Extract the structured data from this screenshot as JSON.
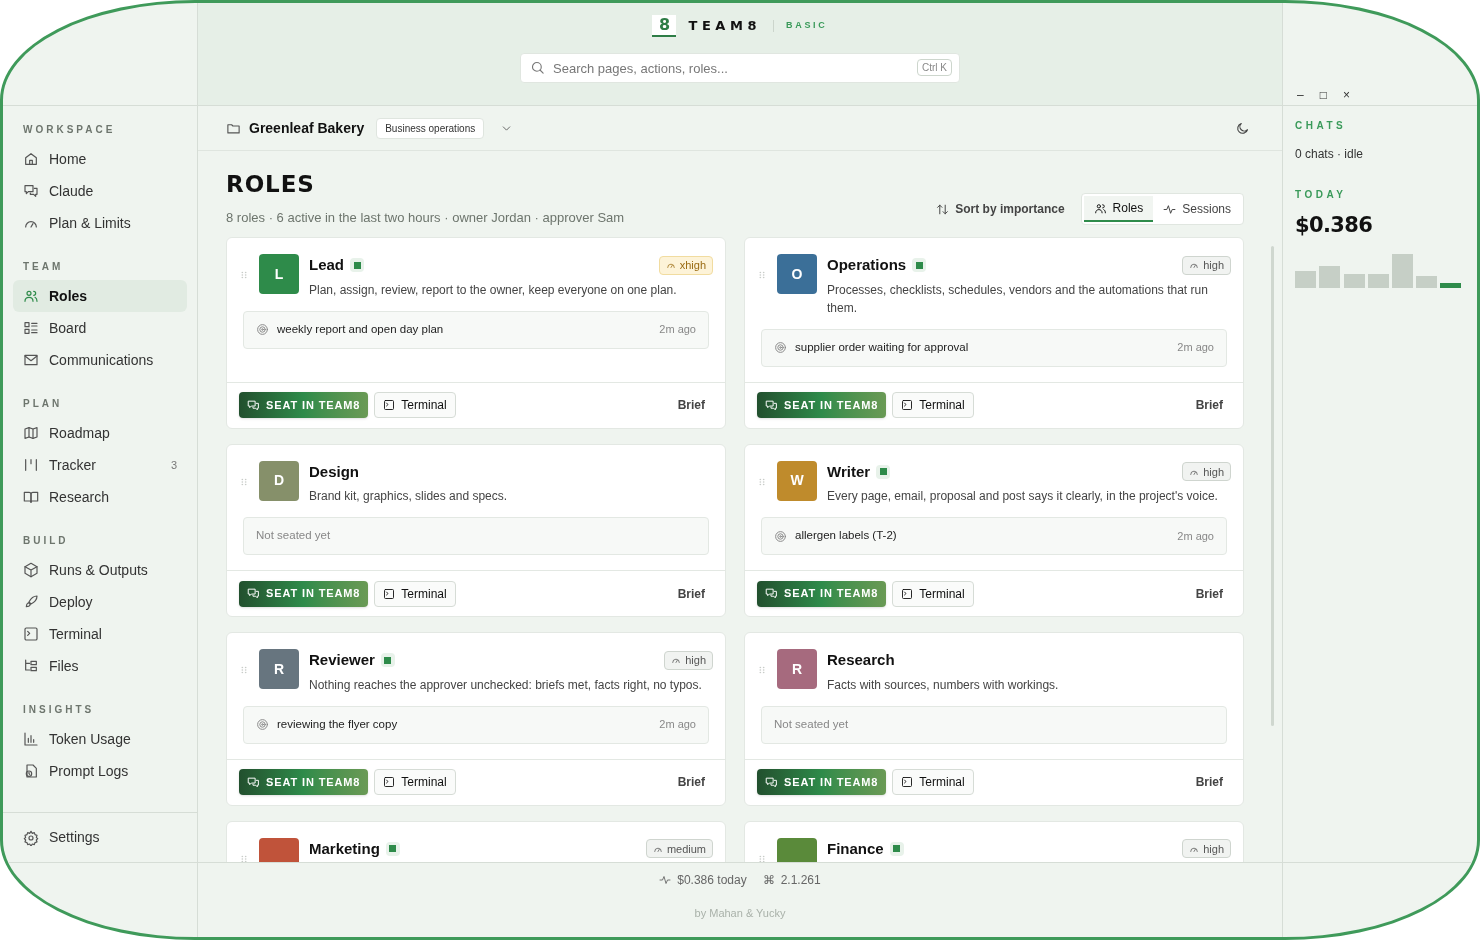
{
  "brand": {
    "logo": "8",
    "name": "TEAM8",
    "plan": "BASIC"
  },
  "search": {
    "placeholder": "Search pages, actions, roles...",
    "shortcut": "Ctrl K"
  },
  "window_controls": [
    "–",
    "□",
    "×"
  ],
  "sidebar": {
    "sections": [
      {
        "title": "WORKSPACE",
        "items": [
          {
            "label": "Home",
            "selected": false
          },
          {
            "label": "Claude",
            "selected": false
          },
          {
            "label": "Plan & Limits",
            "selected": false
          }
        ]
      },
      {
        "title": "TEAM",
        "items": [
          {
            "label": "Roles",
            "selected": true
          },
          {
            "label": "Board",
            "selected": false
          },
          {
            "label": "Communications",
            "selected": false
          }
        ]
      },
      {
        "title": "PLAN",
        "items": [
          {
            "label": "Roadmap",
            "selected": false
          },
          {
            "label": "Tracker",
            "selected": false,
            "count": "3"
          },
          {
            "label": "Research",
            "selected": false
          }
        ]
      },
      {
        "title": "BUILD",
        "items": [
          {
            "label": "Runs & Outputs",
            "selected": false
          },
          {
            "label": "Deploy",
            "selected": false
          },
          {
            "label": "Terminal",
            "selected": false
          },
          {
            "label": "Files",
            "selected": false
          }
        ]
      },
      {
        "title": "INSIGHTS",
        "items": [
          {
            "label": "Token Usage",
            "selected": false
          },
          {
            "label": "Prompt Logs",
            "selected": false
          }
        ]
      }
    ],
    "footer": {
      "label": "Settings"
    }
  },
  "project": {
    "name": "Greenleaf Bakery",
    "tag": "Business operations"
  },
  "page": {
    "title": "ROLES",
    "subtitle": "8 roles · 6 active in the last two hours · owner Jordan · approver Sam",
    "sort": "Sort by importance",
    "tabs": [
      {
        "label": "Roles",
        "selected": true
      },
      {
        "label": "Sessions",
        "selected": false
      }
    ]
  },
  "roles": [
    {
      "initial": "L",
      "color": "#2e8b4a",
      "name": "Lead",
      "online": true,
      "effort": "xhigh",
      "effort_highlighted": true,
      "description": "Plan, assign, review, report to the owner, keep everyone on one plan.",
      "activity": {
        "kind": "task",
        "text": "weekly report and open day plan",
        "time": "2m ago"
      },
      "seat": "SEAT IN TEAM8",
      "terminal": "Terminal",
      "brief": "Brief"
    },
    {
      "initial": "O",
      "color": "#3b6f98",
      "name": "Operations",
      "online": true,
      "effort": "high",
      "effort_highlighted": false,
      "description": "Processes, checklists, schedules, vendors and the automations that run them.",
      "activity": {
        "kind": "task",
        "text": "supplier order waiting for approval",
        "time": "2m ago"
      },
      "seat": "SEAT IN TEAM8",
      "terminal": "Terminal",
      "brief": "Brief"
    },
    {
      "initial": "D",
      "color": "#86906a",
      "name": "Design",
      "online": false,
      "description": "Brand kit, graphics, slides and specs.",
      "activity": {
        "kind": "empty",
        "text": "Not seated yet"
      },
      "seat": "SEAT IN TEAM8",
      "terminal": "Terminal",
      "brief": "Brief"
    },
    {
      "initial": "W",
      "color": "#bf8b2c",
      "name": "Writer",
      "online": true,
      "effort": "high",
      "effort_highlighted": false,
      "description": "Every page, email, proposal and post says it clearly, in the project's voice.",
      "activity": {
        "kind": "task",
        "text": "allergen labels (T-2)",
        "time": "2m ago"
      },
      "seat": "SEAT IN TEAM8",
      "terminal": "Terminal",
      "brief": "Brief"
    },
    {
      "initial": "R",
      "color": "#67757f",
      "name": "Reviewer",
      "online": true,
      "effort": "high",
      "effort_highlighted": false,
      "description": "Nothing reaches the approver unchecked: briefs met, facts right, no typos.",
      "activity": {
        "kind": "task",
        "text": "reviewing the flyer copy",
        "time": "2m ago"
      },
      "seat": "SEAT IN TEAM8",
      "terminal": "Terminal",
      "brief": "Brief"
    },
    {
      "initial": "R",
      "color": "#a66a7e",
      "name": "Research",
      "online": false,
      "description": "Facts with sources, numbers with workings.",
      "activity": {
        "kind": "empty",
        "text": "Not seated yet"
      },
      "seat": "SEAT IN TEAM8",
      "terminal": "Terminal",
      "brief": "Brief"
    },
    {
      "color": "#c0533a",
      "name": "Marketing",
      "online": true,
      "effort": "medium",
      "effort_highlighted": false
    },
    {
      "color": "#5a8a3a",
      "name": "Finance",
      "online": true,
      "effort": "high",
      "effort_highlighted": false
    }
  ],
  "chats": {
    "title": "CHATS",
    "status": "0 chats · idle",
    "today_title": "TODAY",
    "today_amount": "$0.386"
  },
  "status_bar": {
    "cost": "$0.386 today",
    "version_glyph": "⌘",
    "version": "2.1.261",
    "credit": "by Mahan & Yucky"
  }
}
